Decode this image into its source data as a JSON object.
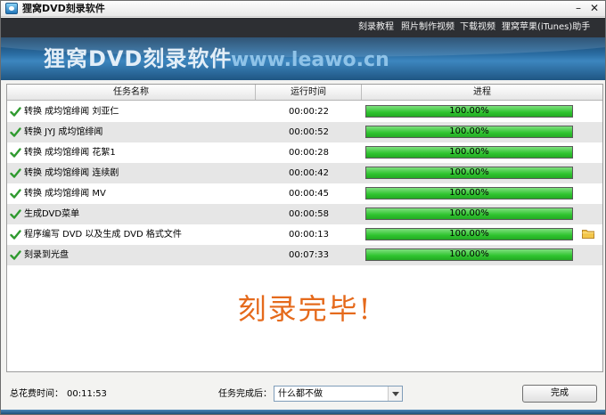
{
  "window": {
    "title": "狸窝DVD刻录软件",
    "minimize": "–",
    "close": "✕"
  },
  "menu": [
    "刻录教程",
    "照片制作视频",
    "下载视频",
    "狸窝苹果(iTunes)助手"
  ],
  "banner": {
    "title": "狸窝DVD刻录软件",
    "url": "www.leawo.cn"
  },
  "table": {
    "headers": {
      "name": "任务名称",
      "time": "运行时间",
      "progress": "进程"
    },
    "rows": [
      {
        "name": "转换 成均馆绯闻 刘亚仁",
        "time": "00:00:22",
        "progress": 1.0,
        "progress_label": "100.00%"
      },
      {
        "name": "转换 JYJ 成均馆绯闻",
        "time": "00:00:52",
        "progress": 1.0,
        "progress_label": "100.00%"
      },
      {
        "name": "转换 成均馆绯闻 花絮1",
        "time": "00:00:28",
        "progress": 1.0,
        "progress_label": "100.00%"
      },
      {
        "name": "转换 成均馆绯闻 连续剧",
        "time": "00:00:42",
        "progress": 1.0,
        "progress_label": "100.00%"
      },
      {
        "name": "转换 成均馆绯闻 MV",
        "time": "00:00:45",
        "progress": 1.0,
        "progress_label": "100.00%"
      },
      {
        "name": "生成DVD菜单",
        "time": "00:00:58",
        "progress": 1.0,
        "progress_label": "100.00%"
      },
      {
        "name": "程序编写 DVD 以及生成 DVD 格式文件",
        "time": "00:00:13",
        "progress": 1.0,
        "progress_label": "100.00%",
        "has_folder": true
      },
      {
        "name": "刻录到光盘",
        "time": "00:07:33",
        "progress": 1.0,
        "progress_label": "100.00%"
      }
    ]
  },
  "message": "刻录完毕!",
  "footer": {
    "total_label": "总花费时间：",
    "total_value": "00:11:53",
    "after_label": "任务完成后：",
    "after_value": "什么都不做",
    "done_button": "完成"
  },
  "colors": {
    "progress": "#2ec42e",
    "message": "#e56a1c",
    "menubar": "#2d2f33"
  }
}
